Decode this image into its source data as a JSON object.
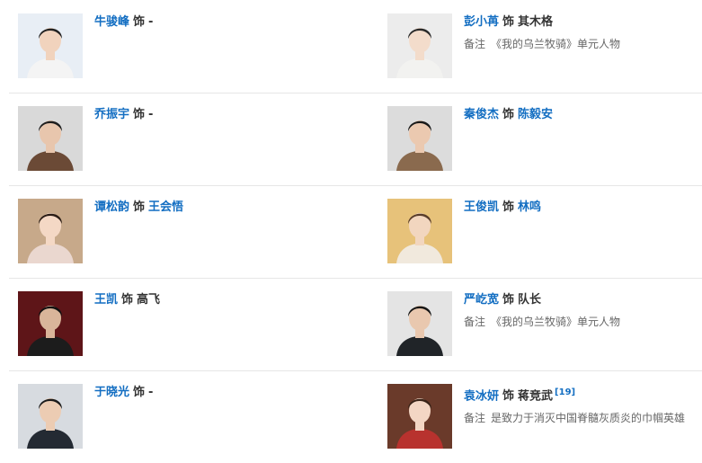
{
  "cast": [
    {
      "actor": "牛骏峰",
      "sep": "饰",
      "role": "-",
      "role_is_link": false,
      "ref": "",
      "note_label": "",
      "note": "",
      "photo": {
        "bg": "#e8eef5",
        "skin": "#f1d3bd",
        "hair": "#222222",
        "cloth": "#f4f4f4"
      }
    },
    {
      "actor": "彭小苒",
      "sep": "饰",
      "role": "其木格",
      "role_is_link": false,
      "ref": "",
      "note_label": "备注",
      "note": "《我的乌兰牧骑》单元人物",
      "photo": {
        "bg": "#ececec",
        "skin": "#f3dccb",
        "hair": "#2a2a2a",
        "cloth": "#f2f2f0"
      }
    },
    {
      "actor": "乔振宇",
      "sep": "饰",
      "role": "-",
      "role_is_link": false,
      "ref": "",
      "note_label": "",
      "note": "",
      "photo": {
        "bg": "#d9d9d9",
        "skin": "#e8c6ad",
        "hair": "#1e1e1e",
        "cloth": "#6b4a36"
      }
    },
    {
      "actor": "秦俊杰",
      "sep": "饰",
      "role": "陈毅安",
      "role_is_link": true,
      "ref": "",
      "note_label": "",
      "note": "",
      "photo": {
        "bg": "#dcdcdc",
        "skin": "#ebc9b0",
        "hair": "#1a1a1a",
        "cloth": "#8a6a4e"
      }
    },
    {
      "actor": "谭松韵",
      "sep": "饰",
      "role": "王会悟",
      "role_is_link": true,
      "ref": "",
      "note_label": "",
      "note": "",
      "photo": {
        "bg": "#c7a98a",
        "skin": "#f4d8c5",
        "hair": "#2b1d16",
        "cloth": "#ead7cf"
      }
    },
    {
      "actor": "王俊凯",
      "sep": "饰",
      "role": "林鸣",
      "role_is_link": true,
      "ref": "",
      "note_label": "",
      "note": "",
      "photo": {
        "bg": "#e7c27a",
        "skin": "#f2d6bf",
        "hair": "#5a3e2b",
        "cloth": "#f1e9dd"
      }
    },
    {
      "actor": "王凯",
      "sep": "饰",
      "role": "高飞",
      "role_is_link": false,
      "ref": "",
      "note_label": "",
      "note": "",
      "photo": {
        "bg": "#5e1518",
        "skin": "#d9b59a",
        "hair": "#111111",
        "cloth": "#1c1c1c"
      }
    },
    {
      "actor": "严屹宽",
      "sep": "饰",
      "role": "队长",
      "role_is_link": false,
      "ref": "",
      "note_label": "备注",
      "note": "《我的乌兰牧骑》单元人物",
      "photo": {
        "bg": "#e4e4e4",
        "skin": "#e9c8af",
        "hair": "#161616",
        "cloth": "#202428"
      }
    },
    {
      "actor": "于晓光",
      "sep": "饰",
      "role": "-",
      "role_is_link": false,
      "ref": "",
      "note_label": "",
      "note": "",
      "photo": {
        "bg": "#d7dbe0",
        "skin": "#ecccb3",
        "hair": "#1b1b1b",
        "cloth": "#242a33"
      }
    },
    {
      "actor": "袁冰妍",
      "sep": "饰",
      "role": "蒋竞武",
      "role_is_link": false,
      "ref": "[19]",
      "note_label": "备注",
      "note": "是致力于消灭中国脊髓灰质炎的巾帼英雄",
      "photo": {
        "bg": "#6a3a2a",
        "skin": "#f3d6c4",
        "hair": "#3a2418",
        "cloth": "#b8322e"
      }
    }
  ]
}
